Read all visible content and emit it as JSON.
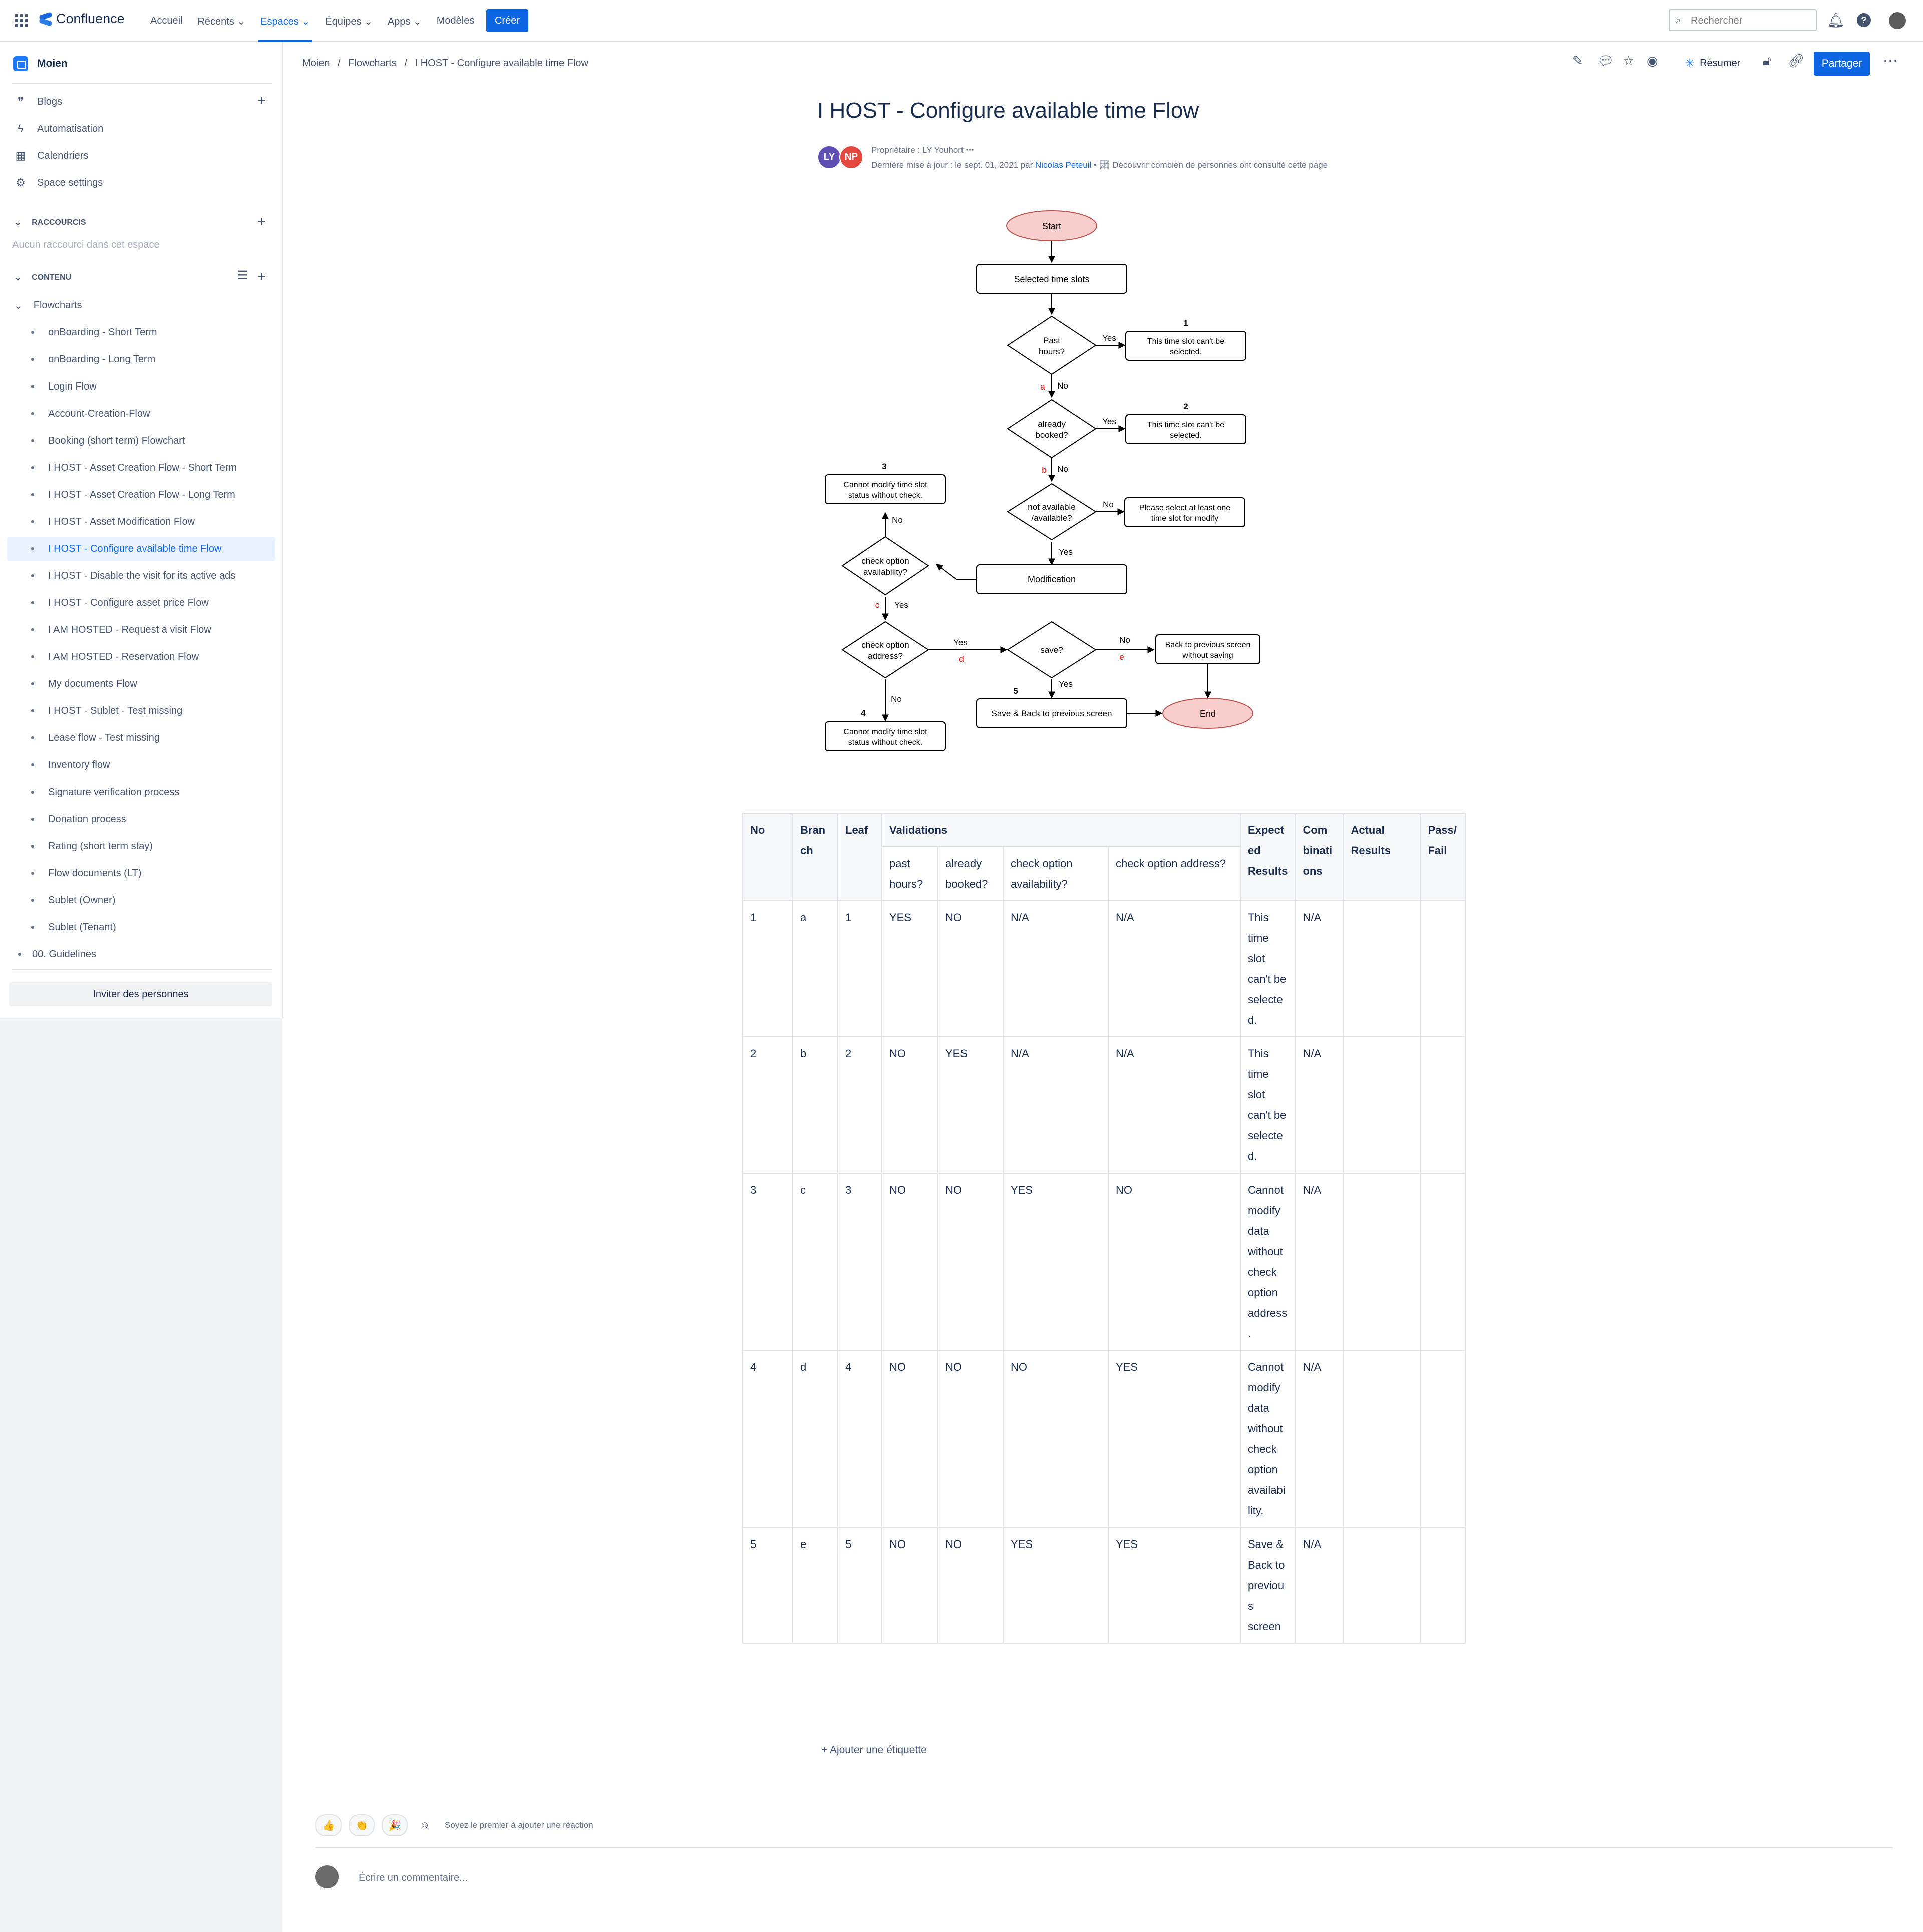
{
  "topnav": {
    "brand": "Confluence",
    "items": [
      {
        "label": "Accueil",
        "chevron": ""
      },
      {
        "label": "Récents",
        "chevron": "⌄"
      },
      {
        "label": "Espaces",
        "chevron": "⌄"
      },
      {
        "label": "Équipes",
        "chevron": "⌄"
      },
      {
        "label": "Apps",
        "chevron": "⌄"
      },
      {
        "label": "Modèles",
        "chevron": ""
      }
    ],
    "create": "Créer",
    "search_placeholder": "Rechercher"
  },
  "sidebar": {
    "space_name": "Moien",
    "links": [
      "Blogs",
      "Automatisation",
      "Calendriers",
      "Space settings"
    ],
    "shortcuts_title": "RACCOURCIS",
    "shortcuts_empty": "Aucun raccourci dans cet espace",
    "content_title": "CONTENU",
    "tree_root": "Flowcharts",
    "tree": [
      "onBoarding - Short Term",
      "onBoarding - Long Term",
      "Login Flow",
      "Account-Creation-Flow",
      "Booking (short term) Flowchart",
      "I HOST - Asset Creation Flow - Short Term",
      "I HOST - Asset Creation Flow - Long Term",
      "I HOST - Asset Modification Flow",
      "I HOST - Configure available time Flow",
      "I HOST - Disable the visit for its active ads",
      "I HOST - Configure asset price Flow",
      "I AM HOSTED - Request a visit Flow",
      "I AM HOSTED - Reservation Flow",
      "My documents Flow",
      "I HOST - Sublet - Test missing",
      "Lease flow - Test missing",
      "Inventory flow",
      "Signature verification process",
      "Donation process",
      "Rating (short term stay)",
      "Flow documents (LT)",
      "Sublet (Owner)",
      "Sublet (Tenant)"
    ],
    "tree_last": "00. Guidelines",
    "invite": "Inviter des personnes"
  },
  "breadcrumb": [
    "Moien",
    "/",
    "Flowcharts",
    "/",
    "I HOST - Configure available time Flow"
  ],
  "toolbar": {
    "summarize": "Résumer",
    "share": "Partager"
  },
  "page": {
    "title": "I HOST - Configure available time Flow",
    "owner": "Propriétaire : LY Youhort",
    "avatars": [
      "LY",
      "NP"
    ],
    "updated_prefix": "Dernière mise à jour : le sept. 01, 2021 par ",
    "updated_by": "Nicolas Peteuil",
    "insights": "Découvrir combien de personnes ont consulté cette page"
  },
  "flowchart": {
    "start": "Start",
    "end": "End",
    "selected": "Selected time slots",
    "past_1": "Past",
    "past_2": "hours?",
    "booked_1": "already",
    "booked_2": "booked?",
    "notavail_1": "not available",
    "notavail_2": "/available?",
    "modification": "Modification",
    "avail_1": "check option",
    "avail_2": "availability?",
    "address_1": "check option",
    "address_2": "address?",
    "save": "save?",
    "box1_1": "This time slot can't be",
    "box1_2": "selected.",
    "box2_1": "This time slot can't be",
    "box2_2": "selected.",
    "boxpls_1": "Please select at least one",
    "boxpls_2": "time slot for modify",
    "box3_1": "Cannot  modify time slot",
    "box3_2": "status without check.",
    "box4_1": "Cannot  modify time slot",
    "box4_2": "status without check.",
    "back_1": "Back to previous screen",
    "back_2": "without saving",
    "saveback": "Save & Back to previous screen",
    "yes": "Yes",
    "no": "No",
    "n1": "1",
    "n2": "2",
    "n3": "3",
    "n4": "4",
    "n5": "5",
    "a": "a",
    "b": "b",
    "c": "c",
    "d": "d",
    "e": "e"
  },
  "table": {
    "headers": [
      "No",
      "Bran ch",
      "Leaf",
      "Validations",
      "Expect ed Results",
      "Com binati ons",
      "Actual Results",
      "Pass/ Fail"
    ],
    "validation_headers": [
      "past hours?",
      "already booked?",
      "check option availability?",
      "check option address?"
    ],
    "rows": [
      [
        "1",
        "a",
        "1",
        "YES",
        "NO",
        "N/A",
        "N/A",
        "This time slot can't be selecte d.",
        "N/A",
        "",
        ""
      ],
      [
        "2",
        "b",
        "2",
        "NO",
        "YES",
        "N/A",
        "N/A",
        "This time slot can't be selecte d.",
        "N/A",
        "",
        ""
      ],
      [
        "3",
        "c",
        "3",
        "NO",
        "NO",
        "YES",
        "NO",
        "Cannot modify data without check option address .",
        "N/A",
        "",
        ""
      ],
      [
        "4",
        "d",
        "4",
        "NO",
        "NO",
        "NO",
        "YES",
        "Cannot modify data without check option availabi lity.",
        "N/A",
        "",
        ""
      ],
      [
        "5",
        "e",
        "5",
        "NO",
        "NO",
        "YES",
        "YES",
        "Save & Back to previou s screen",
        "N/A",
        "",
        ""
      ]
    ]
  },
  "footer": {
    "add_label": "Ajouter une étiquette",
    "reactions": [
      "👍",
      "👏",
      "🎉"
    ],
    "react_first": "Soyez le premier à ajouter une réaction",
    "comment_placeholder": "Écrire un commentaire..."
  },
  "colors": {
    "accent": "#0c66e4",
    "terminal_fill": "#f8cecc",
    "terminal_stroke": "#b85450",
    "branch_label": "#ff0000"
  }
}
